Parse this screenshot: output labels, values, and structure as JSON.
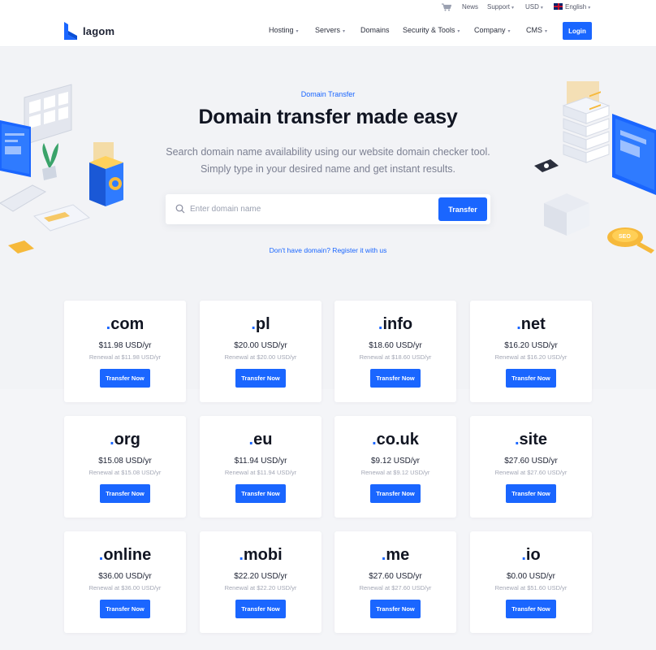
{
  "topbar": {
    "news": "News",
    "support": "Support",
    "currency": "USD",
    "language": "English"
  },
  "header": {
    "logo_text": "lagom",
    "nav": [
      {
        "label": "Hosting",
        "dropdown": true
      },
      {
        "label": "Servers",
        "dropdown": true
      },
      {
        "label": "Domains",
        "dropdown": false
      },
      {
        "label": "Security & Tools",
        "dropdown": true
      },
      {
        "label": "Company",
        "dropdown": true
      },
      {
        "label": "CMS",
        "dropdown": true
      }
    ],
    "login_label": "Login"
  },
  "hero": {
    "eyebrow": "Domain Transfer",
    "title": "Domain transfer made easy",
    "subtitle_line1": "Search domain name availability using our website domain checker tool.",
    "subtitle_line2": "Simply type in your desired name and get instant results.",
    "search_placeholder": "Enter domain name",
    "search_value": "",
    "transfer_label": "Transfer",
    "register_link": "Don't have domain? Register it with us"
  },
  "cards": [
    {
      "tld": "com",
      "price": "$11.98 USD/yr",
      "renewal": "Renewal at $11.98 USD/yr",
      "button": "Transfer Now"
    },
    {
      "tld": "pl",
      "price": "$20.00 USD/yr",
      "renewal": "Renewal at $20.00 USD/yr",
      "button": "Transfer Now"
    },
    {
      "tld": "info",
      "price": "$18.60 USD/yr",
      "renewal": "Renewal at $18.60 USD/yr",
      "button": "Transfer Now"
    },
    {
      "tld": "net",
      "price": "$16.20 USD/yr",
      "renewal": "Renewal at $16.20 USD/yr",
      "button": "Transfer Now"
    },
    {
      "tld": "org",
      "price": "$15.08 USD/yr",
      "renewal": "Renewal at $15.08 USD/yr",
      "button": "Transfer Now"
    },
    {
      "tld": "eu",
      "price": "$11.94 USD/yr",
      "renewal": "Renewal at $11.94 USD/yr",
      "button": "Transfer Now"
    },
    {
      "tld": "co.uk",
      "price": "$9.12 USD/yr",
      "renewal": "Renewal at $9.12 USD/yr",
      "button": "Transfer Now"
    },
    {
      "tld": "site",
      "price": "$27.60 USD/yr",
      "renewal": "Renewal at $27.60 USD/yr",
      "button": "Transfer Now"
    },
    {
      "tld": "online",
      "price": "$36.00 USD/yr",
      "renewal": "Renewal at $36.00 USD/yr",
      "button": "Transfer Now"
    },
    {
      "tld": "mobi",
      "price": "$22.20 USD/yr",
      "renewal": "Renewal at $22.20 USD/yr",
      "button": "Transfer Now"
    },
    {
      "tld": "me",
      "price": "$27.60 USD/yr",
      "renewal": "Renewal at $27.60 USD/yr",
      "button": "Transfer Now"
    },
    {
      "tld": "io",
      "price": "$0.00 USD/yr",
      "renewal": "Renewal at $51.60 USD/yr",
      "button": "Transfer Now"
    }
  ],
  "icons": {
    "cart": "cart-icon",
    "flag": "uk-flag-icon",
    "search": "search-icon",
    "logo": "lagom-logo-icon"
  },
  "colors": {
    "accent": "#1a66ff",
    "background": "#f4f5f8",
    "card": "#ffffff",
    "heading": "#111522"
  }
}
